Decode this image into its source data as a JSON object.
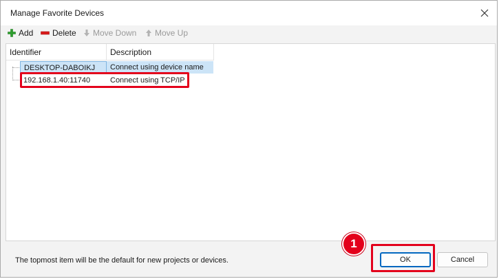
{
  "window": {
    "title": "Manage Favorite Devices"
  },
  "toolbar": {
    "add_label": "Add",
    "delete_label": "Delete",
    "move_down_label": "Move Down",
    "move_up_label": "Move Up",
    "add_color": "#2e9e2e",
    "delete_color": "#d9191a"
  },
  "list": {
    "columns": [
      "Identifier",
      "Description"
    ],
    "rows": [
      {
        "identifier": "DESKTOP-DABOIKJ",
        "description": "Connect using device name",
        "selected": true
      },
      {
        "identifier": "192.168.1.40:11740",
        "description": "Connect using TCP/IP",
        "selected": false,
        "highlighted": true
      }
    ]
  },
  "footer": {
    "info_text": "The topmost item will be the default for new projects or devices.",
    "ok_label": "OK",
    "cancel_label": "Cancel"
  },
  "annotation": {
    "step_number": "1",
    "highlight_color": "#e3001b"
  }
}
